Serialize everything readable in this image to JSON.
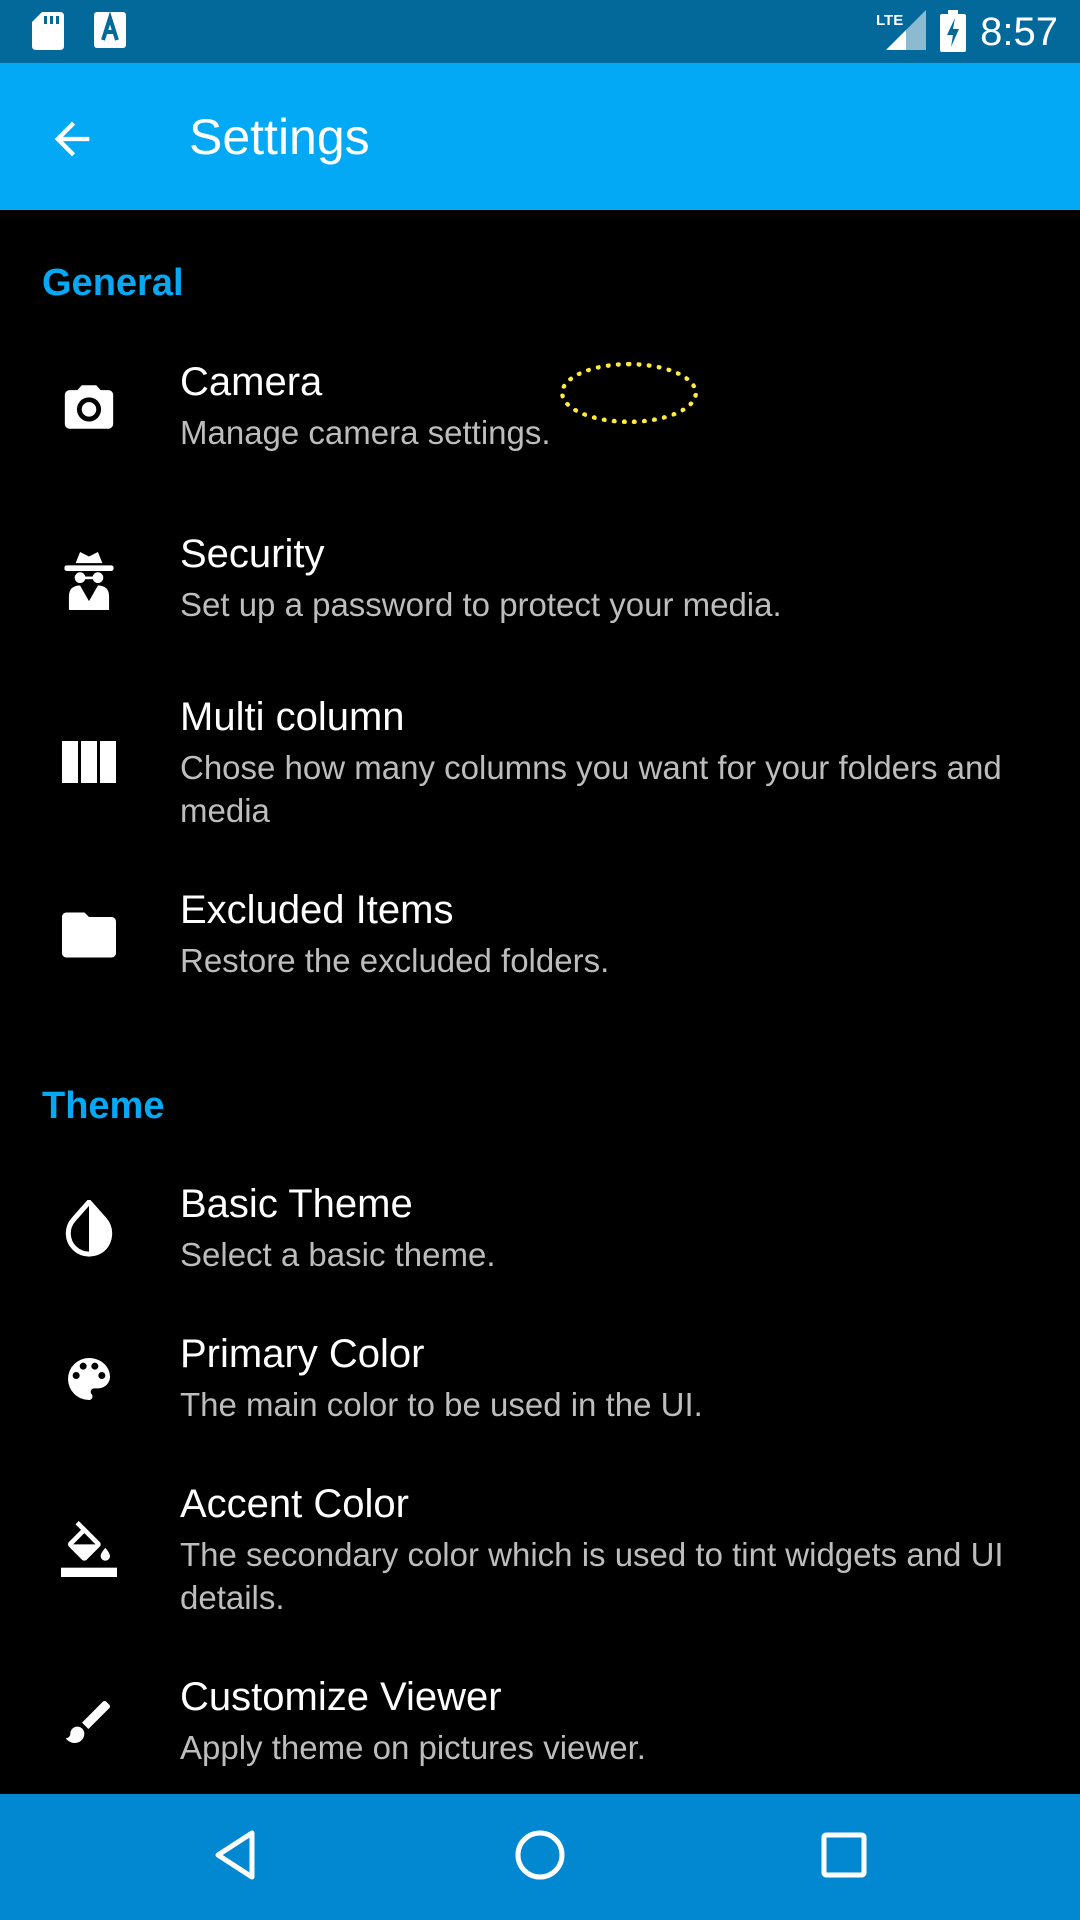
{
  "status_bar": {
    "time": "8:57",
    "network_label": "LTE",
    "icons": [
      "sd-card-icon",
      "keyboard-a-icon",
      "lte-signal-icon",
      "battery-charging-icon"
    ]
  },
  "app_bar": {
    "title": "Settings",
    "back_icon": "arrow-back-icon"
  },
  "sections": {
    "general": {
      "header": "General",
      "items": [
        {
          "title": "Camera",
          "summary": "Manage camera settings.",
          "icon": "camera-icon"
        },
        {
          "title": "Security",
          "summary": "Set up a password to protect your media.",
          "icon": "incognito-icon"
        },
        {
          "title": "Multi column",
          "summary": "Chose how many columns you want for your folders and media",
          "icon": "view-columns-icon"
        },
        {
          "title": "Excluded Items",
          "summary": "Restore the excluded folders.",
          "icon": "folder-icon"
        }
      ]
    },
    "theme": {
      "header": "Theme",
      "items": [
        {
          "title": "Basic Theme",
          "summary": "Select a basic theme.",
          "icon": "invert-colors-icon"
        },
        {
          "title": "Primary Color",
          "summary": "The main color to be used in the UI.",
          "icon": "palette-icon"
        },
        {
          "title": "Accent Color",
          "summary": "The secondary color which is used to tint widgets and UI details.",
          "icon": "format-color-fill-icon"
        },
        {
          "title": "Customize Viewer",
          "summary": "Apply theme on pictures viewer.",
          "icon": "brush-icon"
        }
      ]
    }
  },
  "nav_bar": {
    "icons": [
      "nav-back-icon",
      "nav-home-icon",
      "nav-recents-icon"
    ]
  },
  "colors": {
    "status_bar": "#02699a",
    "app_bar": "#03a9f4",
    "accent": "#03a9f4",
    "background": "#000000",
    "summary_text": "#bdbdbd",
    "nav_bar": "#0288d1"
  }
}
